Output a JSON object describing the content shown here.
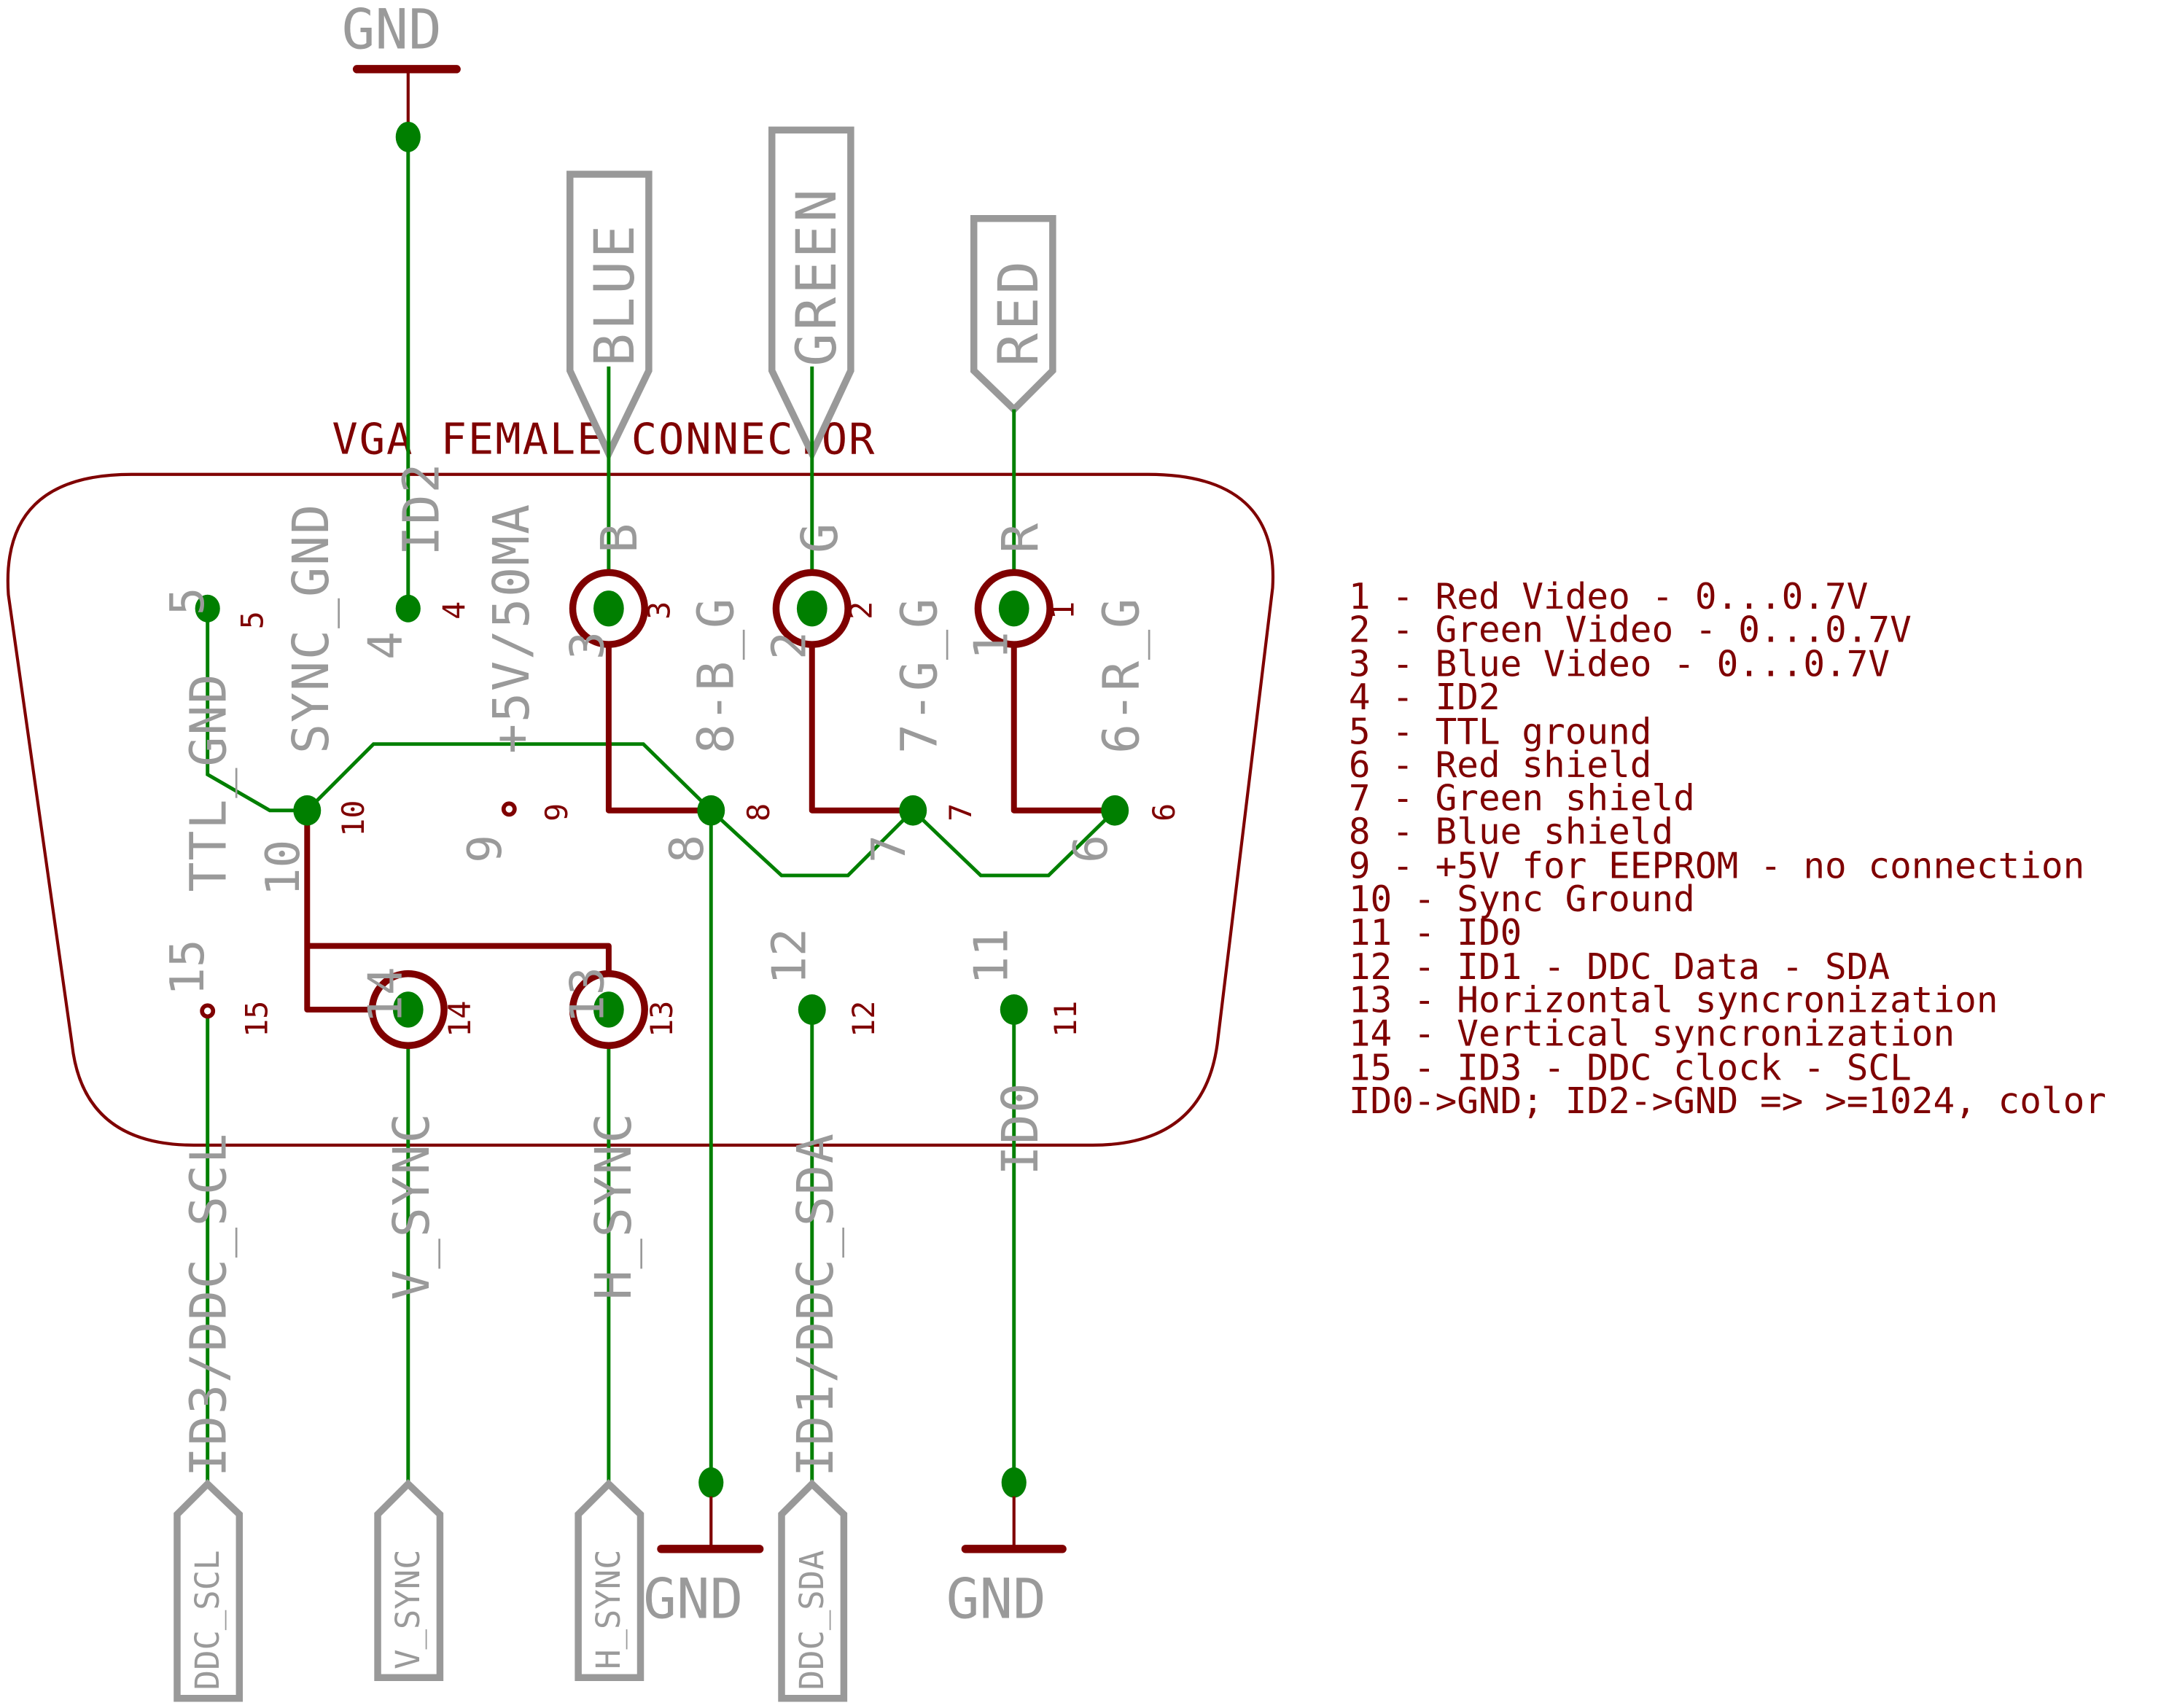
{
  "diagram": {
    "title": "VGA FEMALE CONNECTOR",
    "colors": {
      "wire": "#007f00",
      "outline": "#7f0000",
      "label": "#9a9a9a",
      "annotation": "#7f0000"
    },
    "ground_symbols": [
      {
        "id": "gnd-top",
        "label": "GND"
      },
      {
        "id": "gnd-bottom-shield",
        "label": "GND"
      },
      {
        "id": "gnd-bottom-id0",
        "label": "GND"
      }
    ],
    "net_flags_top": [
      {
        "id": "blue",
        "label": "BLUE"
      },
      {
        "id": "green",
        "label": "GREEN"
      },
      {
        "id": "red",
        "label": "RED"
      }
    ],
    "net_flags_bottom": [
      {
        "id": "ddc-scl",
        "label": "DDC_SCL"
      },
      {
        "id": "v-sync",
        "label": "V_SYNC"
      },
      {
        "id": "h-sync",
        "label": "H_SYNC"
      },
      {
        "id": "ddc-sda",
        "label": "DDC_SDA"
      }
    ],
    "pin_names": {
      "p5": "TTL_GND",
      "p10": "SYNC_GND",
      "p4": "ID2",
      "p9": "+5V/50MA",
      "p3": "B",
      "p8": "8-B_G",
      "p2": "G",
      "p7": "7-G_G",
      "p1": "R",
      "p6": "6-R_G",
      "p15": "ID3/DDC_SCL",
      "p14": "V_SYNC",
      "p13": "H_SYNC",
      "p12": "ID1/DDC_SDA",
      "p11": "ID0"
    },
    "pin_numbers": {
      "p1": "1",
      "p2": "2",
      "p3": "3",
      "p4": "4",
      "p5": "5",
      "p6": "6",
      "p7": "7",
      "p8": "8",
      "p9": "9",
      "p10": "10",
      "p11": "11",
      "p12": "12",
      "p13": "13",
      "p14": "14",
      "p15": "15"
    },
    "legend": [
      "1 - Red Video - 0...0.7V",
      "2 - Green Video - 0...0.7V",
      "3 - Blue Video - 0...0.7V",
      "4 - ID2",
      "5 - TTL ground",
      "6 - Red shield",
      "7 - Green shield",
      "8 - Blue shield",
      "9 - +5V for EEPROM - no connection",
      "10 - Sync Ground",
      "11 - ID0",
      "12 -  ID1 - DDC Data - SDA",
      "13 - Horizontal syncronization",
      "14 - Vertical syncronization",
      "15 - ID3 - DDC clock - SCL",
      "ID0->GND; ID2->GND => >=1024, color"
    ]
  }
}
